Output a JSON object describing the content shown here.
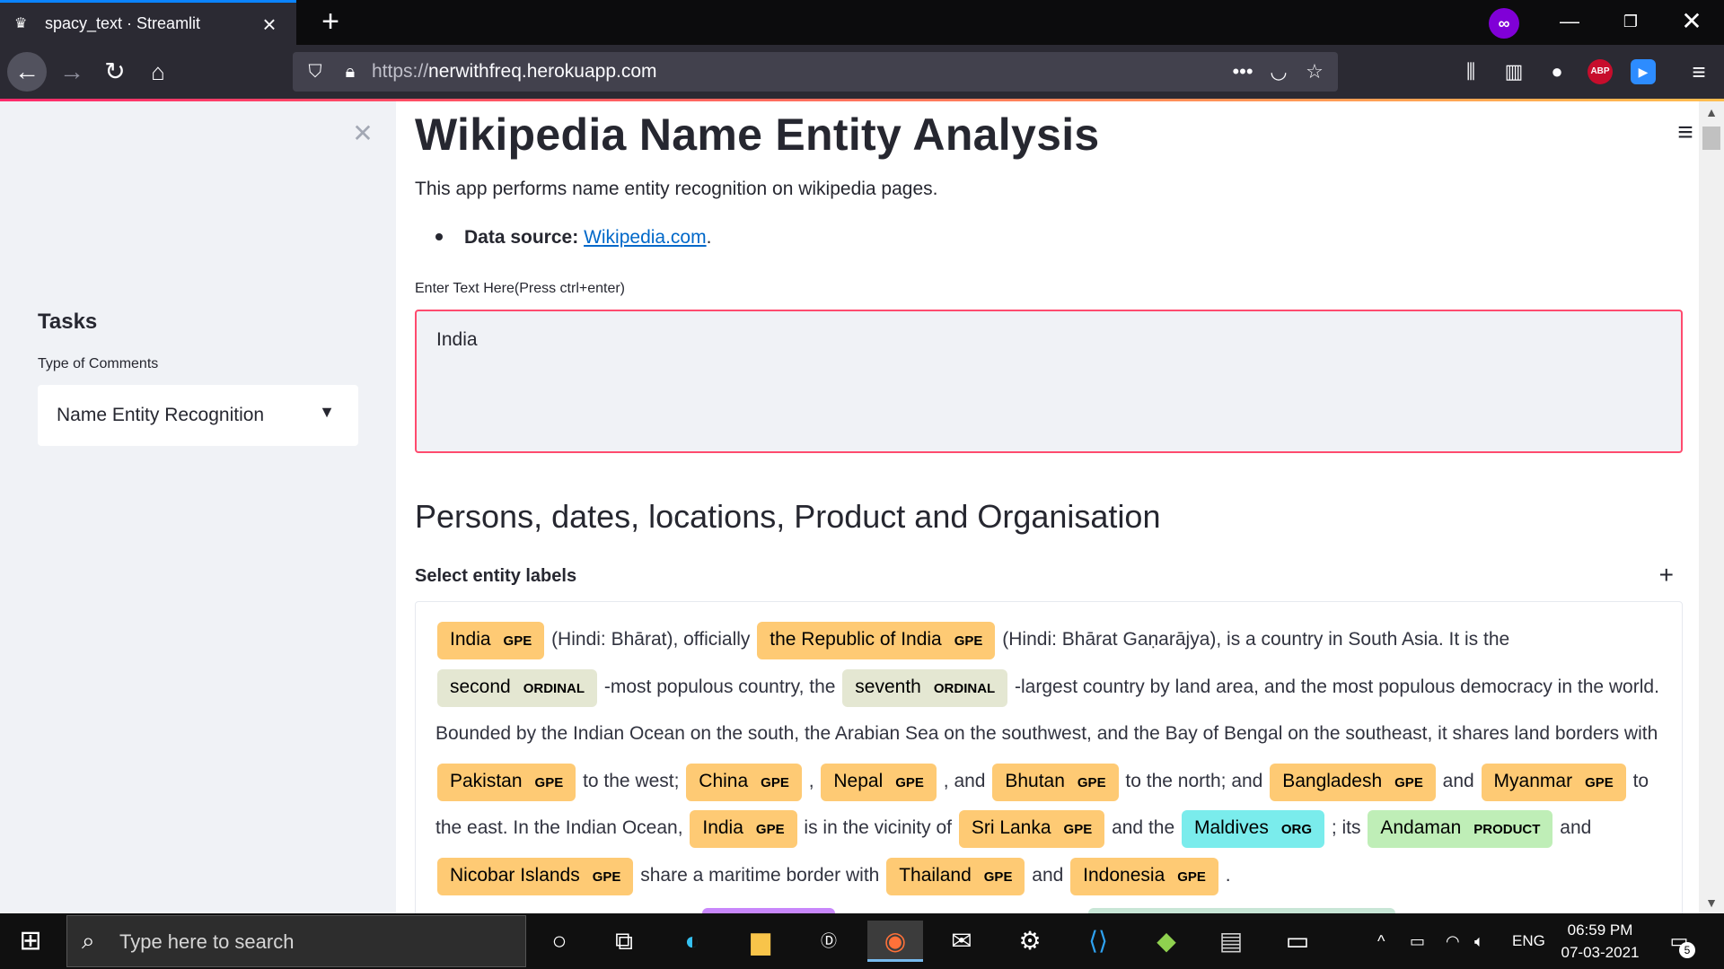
{
  "browser": {
    "tab_title": "spacy_text · Streamlit",
    "url_protocol": "https://",
    "url_host": "nerwithfreq.herokuapp.com",
    "icons": [
      "streamlit-crown-icon",
      "close-tab-icon",
      "new-tab-icon",
      "private-browsing-icon",
      "minimize-icon",
      "restore-icon",
      "close-window-icon",
      "back-icon",
      "forward-icon",
      "reload-icon",
      "home-icon",
      "shield-icon",
      "lock-icon",
      "page-actions-icon",
      "pocket-icon",
      "bookmark-star-icon",
      "library-icon",
      "sidebar-icon",
      "account-icon",
      "adblock-icon",
      "zoom-extension-icon",
      "menu-icon"
    ],
    "abp_label": "ABP"
  },
  "sidebar": {
    "heading": "Tasks",
    "select_label": "Type of Comments",
    "select_value": "Name Entity Recognition"
  },
  "main": {
    "title": "Wikipedia Name Entity Analysis",
    "intro": "This app performs name entity recognition on wikipedia pages.",
    "source_label": "Data source:",
    "source_link": "Wikipedia.com",
    "source_suffix": ".",
    "input_label": "Enter Text Here(Press ctrl+enter)",
    "input_value": "India",
    "subheader": "Persons, dates, locations, Product and Organisation",
    "expander_label": "Select entity labels",
    "entity_colors": {
      "GPE": "#feca74",
      "ORDINAL": "#e4e7d2",
      "ORG": "#7aecec",
      "PRODUCT": "#bfeeb7"
    },
    "entity_text": [
      {
        "type": "ent",
        "text": "India",
        "label": "GPE"
      },
      {
        "type": "txt",
        "text": " (Hindi: Bhārat), officially "
      },
      {
        "type": "ent",
        "text": "the Republic of India",
        "label": "GPE"
      },
      {
        "type": "txt",
        "text": " (Hindi: Bhārat Gaṇarājya), is a country in South Asia. It is the "
      },
      {
        "type": "ent",
        "text": "second",
        "label": "ORDINAL"
      },
      {
        "type": "txt",
        "text": " -most populous country, the "
      },
      {
        "type": "ent",
        "text": "seventh",
        "label": "ORDINAL"
      },
      {
        "type": "txt",
        "text": " -largest country by land area, and the most populous democracy in the world. Bounded by the Indian Ocean on the south, the Arabian Sea on the southwest, and the Bay of Bengal on the southeast, it shares land borders with "
      },
      {
        "type": "ent",
        "text": "Pakistan",
        "label": "GPE"
      },
      {
        "type": "txt",
        "text": " to the west; "
      },
      {
        "type": "ent",
        "text": "China",
        "label": "GPE"
      },
      {
        "type": "txt",
        "text": " , "
      },
      {
        "type": "ent",
        "text": "Nepal",
        "label": "GPE"
      },
      {
        "type": "txt",
        "text": " , and "
      },
      {
        "type": "ent",
        "text": "Bhutan",
        "label": "GPE"
      },
      {
        "type": "txt",
        "text": " to the north; and "
      },
      {
        "type": "ent",
        "text": "Bangladesh",
        "label": "GPE"
      },
      {
        "type": "txt",
        "text": " and "
      },
      {
        "type": "ent",
        "text": "Myanmar",
        "label": "GPE"
      },
      {
        "type": "txt",
        "text": " to the east. In the Indian Ocean, "
      },
      {
        "type": "ent",
        "text": "India",
        "label": "GPE"
      },
      {
        "type": "txt",
        "text": " is in the vicinity of "
      },
      {
        "type": "ent",
        "text": "Sri Lanka",
        "label": "GPE"
      },
      {
        "type": "txt",
        "text": " and the "
      },
      {
        "type": "ent",
        "text": "Maldives",
        "label": "ORG"
      },
      {
        "type": "txt",
        "text": " ; its "
      },
      {
        "type": "ent",
        "text": "Andaman",
        "label": "PRODUCT"
      },
      {
        "type": "txt",
        "text": " and "
      },
      {
        "type": "ent",
        "text": "Nicobar Islands",
        "label": "GPE"
      },
      {
        "type": "txt",
        "text": " share a maritime border with "
      },
      {
        "type": "ent",
        "text": "Thailand",
        "label": "GPE"
      },
      {
        "type": "txt",
        "text": " and "
      },
      {
        "type": "ent",
        "text": "Indonesia",
        "label": "GPE"
      },
      {
        "type": "txt",
        "text": " ."
      }
    ]
  },
  "taskbar": {
    "search_placeholder": "Type here to search",
    "language": "ENG",
    "time": "06:59 PM",
    "date": "07-03-2021",
    "notification_count": "5",
    "apps": [
      "cortana-icon",
      "task-view-icon",
      "edge-icon",
      "file-explorer-icon",
      "dell-icon",
      "firefox-icon",
      "mail-icon",
      "settings-icon",
      "vscode-icon",
      "git-icon",
      "app-icon",
      "terminal-icon"
    ]
  }
}
